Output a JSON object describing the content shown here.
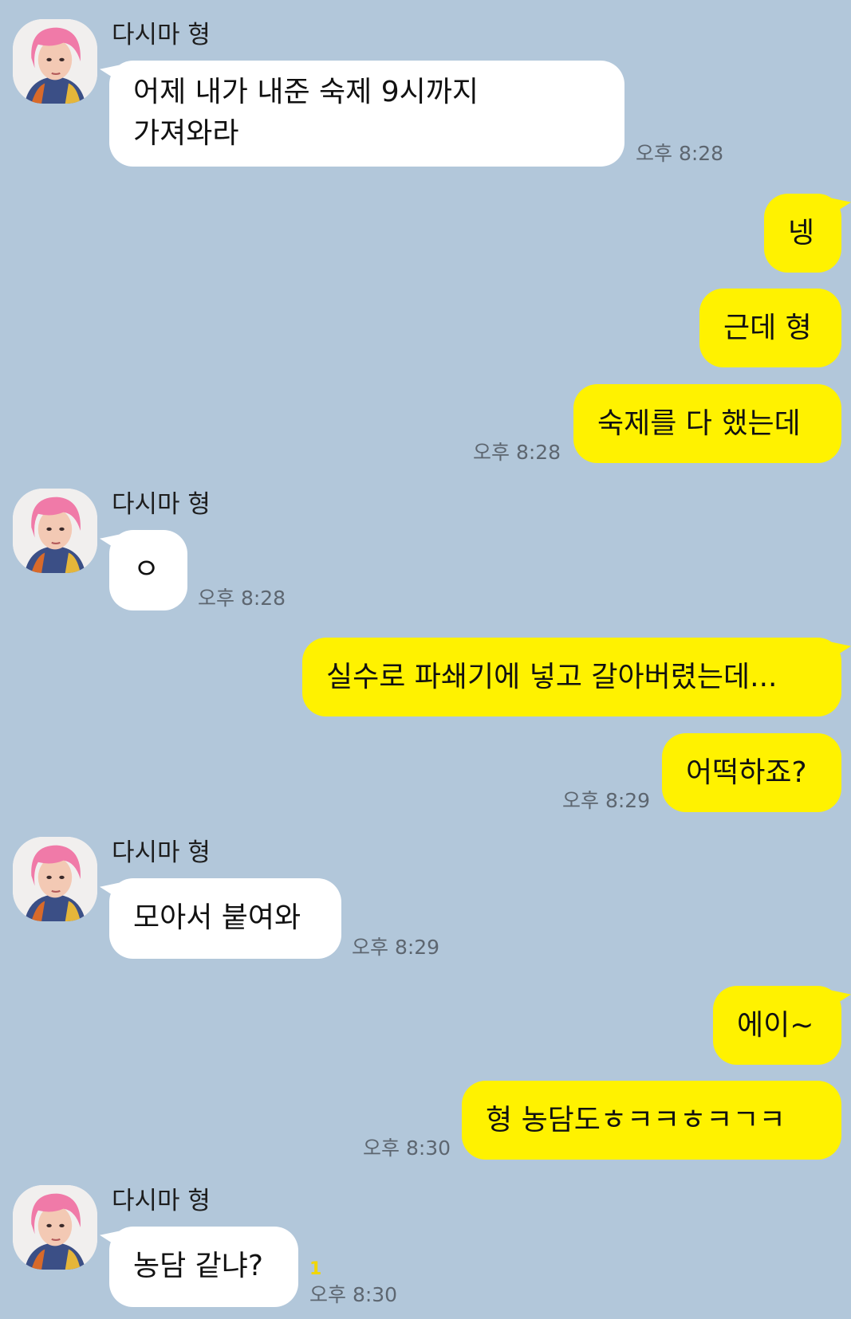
{
  "chat": {
    "contact_name": "다시마 형",
    "messages": [
      {
        "from": "them",
        "lines": [
          "어제 내가 내준 숙제 9시까지",
          "가져와라"
        ],
        "time": "오후 8:28"
      },
      {
        "from": "me",
        "text": "넹"
      },
      {
        "from": "me",
        "text": "근데 형"
      },
      {
        "from": "me",
        "text": "숙제를 다 했는데",
        "time": "오후 8:28"
      },
      {
        "from": "them",
        "text": "ㅇ",
        "time": "오후 8:28"
      },
      {
        "from": "me",
        "text": "실수로 파쇄기에 넣고 갈아버렸는데..."
      },
      {
        "from": "me",
        "text": "어떡하죠?",
        "time": "오후 8:29"
      },
      {
        "from": "them",
        "text": "모아서 붙여와",
        "time": "오후 8:29"
      },
      {
        "from": "me",
        "text": "에이~"
      },
      {
        "from": "me",
        "text": "형 농담도ㅎㅋㅋㅎㅋㄱㅋ",
        "time": "오후 8:30"
      },
      {
        "from": "them",
        "text": "농담 같냐?",
        "time": "오후 8:30",
        "unread": "1"
      }
    ]
  },
  "colors": {
    "background": "#b2c7da",
    "incoming_bubble": "#ffffff",
    "outgoing_bubble": "#fff200",
    "unread_count": "#f2d600"
  },
  "icons": {
    "avatar": "profile-photo-pink-hair"
  }
}
